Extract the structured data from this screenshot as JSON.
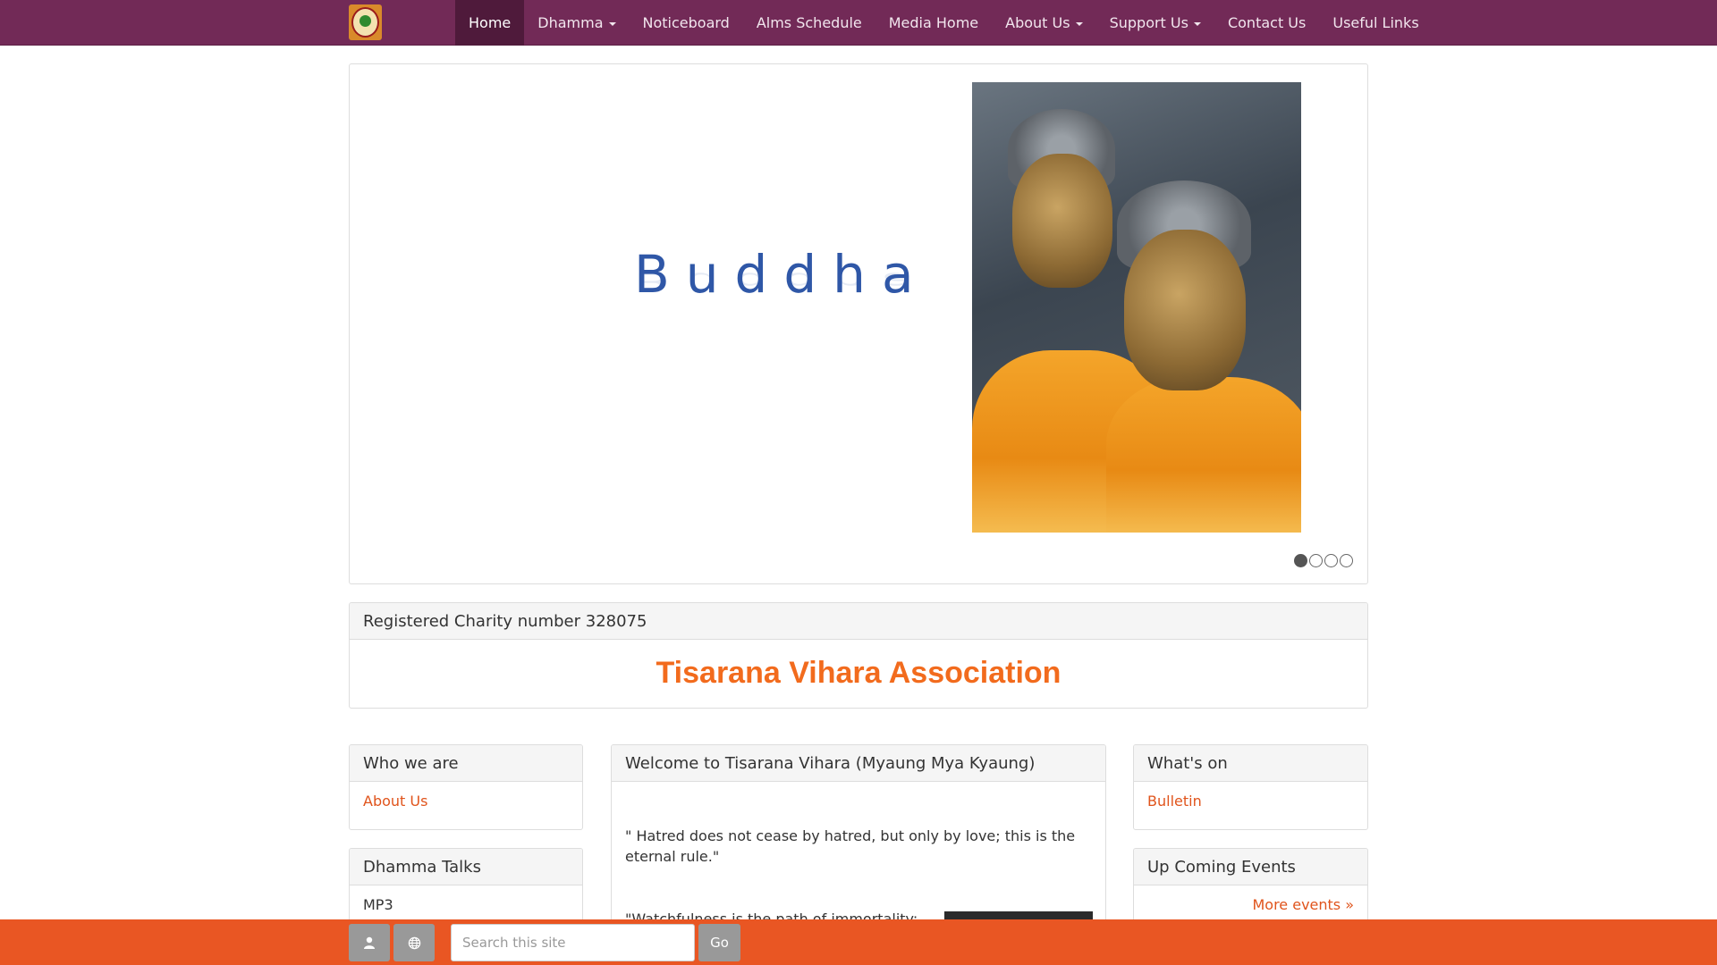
{
  "nav": {
    "items": [
      {
        "label": "Home",
        "active": true,
        "dropdown": false
      },
      {
        "label": "Dhamma",
        "active": false,
        "dropdown": true
      },
      {
        "label": "Noticeboard",
        "active": false,
        "dropdown": false
      },
      {
        "label": "Alms Schedule",
        "active": false,
        "dropdown": false
      },
      {
        "label": "Media Home",
        "active": false,
        "dropdown": false
      },
      {
        "label": "About Us",
        "active": false,
        "dropdown": true
      },
      {
        "label": "Support Us",
        "active": false,
        "dropdown": true
      },
      {
        "label": "Contact Us",
        "active": false,
        "dropdown": false
      },
      {
        "label": "Useful Links",
        "active": false,
        "dropdown": false
      }
    ]
  },
  "slider": {
    "caption": "Buddha",
    "slide_count": 4,
    "active_slide": 1
  },
  "charity": {
    "heading": "Registered Charity number 328075",
    "title": "Tisarana Vihara Association"
  },
  "left": {
    "who": {
      "heading": "Who we are",
      "link": "About Us"
    },
    "talks": {
      "heading": "Dhamma Talks",
      "item": "MP3"
    }
  },
  "center": {
    "heading": "Welcome to Tisarana Vihara (Myaung Mya Kyaung)",
    "quote1": "\" Hatred does not cease by hatred, but only by love; this is the eternal rule.\"",
    "quote2": "\"Watchfulness is the path of immortality:"
  },
  "right": {
    "whatson": {
      "heading": "What's on",
      "link": "Bulletin"
    },
    "events": {
      "heading": "Up Coming Events",
      "link": "More events »"
    }
  },
  "footer": {
    "search_placeholder": "Search this site",
    "go_label": "Go"
  },
  "colors": {
    "navbar": "#722a57",
    "accent": "#e95623",
    "title": "#f26b1d"
  },
  "icons": [
    "logo-icon",
    "user-icon",
    "globe-icon",
    "caret-down-icon"
  ]
}
